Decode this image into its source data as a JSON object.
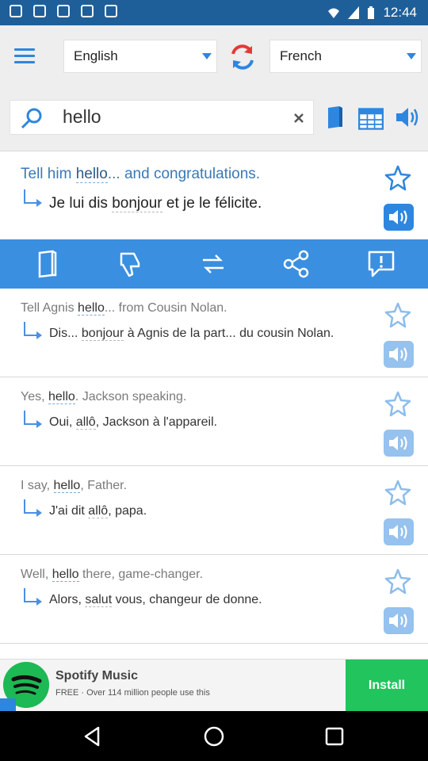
{
  "status_bar": {
    "time": "12:44"
  },
  "toolbar": {
    "source_language": "English",
    "target_language": "French"
  },
  "search": {
    "query": "hello"
  },
  "main_result": {
    "source_before": "Tell him ",
    "source_highlight": "hello",
    "source_after": "... and congratulations.",
    "target_before": "Je lui dis ",
    "target_highlight": "bonjour",
    "target_after": " et je le félicite."
  },
  "results": [
    {
      "source_before": "Tell Agnis ",
      "source_highlight": "hello",
      "source_after": "... from Cousin Nolan.",
      "target_before": "Dis... ",
      "target_highlight": "bonjour",
      "target_after": " à Agnis de la part... du cousin Nolan."
    },
    {
      "source_before": "Yes, ",
      "source_highlight": "hello",
      "source_after": ". Jackson speaking.",
      "target_before": "Oui, ",
      "target_highlight": "allô",
      "target_after": ", Jackson à l'appareil."
    },
    {
      "source_before": "I say, ",
      "source_highlight": "hello",
      "source_after": ", Father.",
      "target_before": "J'ai dit ",
      "target_highlight": "allô",
      "target_after": ", papa."
    },
    {
      "source_before": "Well, ",
      "source_highlight": "hello",
      "source_after": " there, game-changer.",
      "target_before": "Alors, ",
      "target_highlight": "salut",
      "target_after": " vous, changeur de donne."
    }
  ],
  "ad": {
    "title": "Spotify Music",
    "subtitle": "FREE · Over 114 million people use this",
    "install_label": "Install"
  },
  "colors": {
    "accent": "#3a8fe0",
    "status_bar": "#1f5f99",
    "ad_install": "#21c45d"
  },
  "icons": {
    "menu": "hamburger-menu-icon",
    "swap": "swap-languages-icon",
    "search": "search-icon",
    "clear": "close-icon",
    "dictionary": "book-icon",
    "conjugation": "table-icon",
    "speaker": "speaker-icon",
    "favorite": "star-icon",
    "dislike": "thumbs-down-icon",
    "reverse": "reverse-arrows-icon",
    "share": "share-icon",
    "report": "report-icon"
  }
}
